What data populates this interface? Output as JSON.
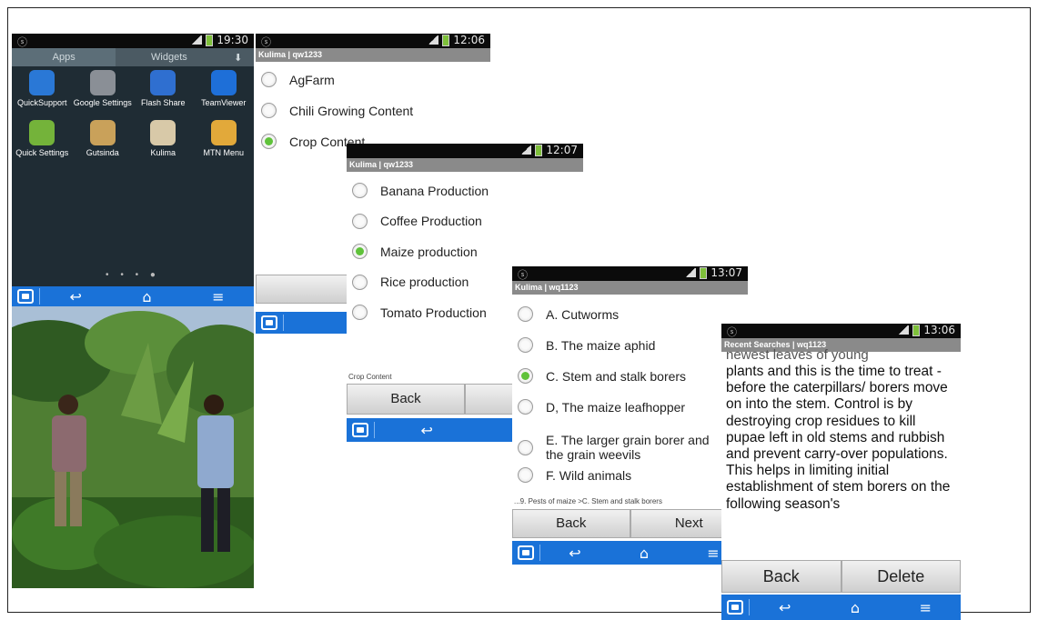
{
  "launcher": {
    "status_time": "19:30",
    "tabs": [
      "Apps",
      "Widgets"
    ],
    "apps": [
      {
        "label": "QuickSupport",
        "icon": "quicksupport-icon",
        "color": "#2a78d6"
      },
      {
        "label": "Google Settings",
        "icon": "google-settings-icon",
        "color": "#8a8f96"
      },
      {
        "label": "Flash Share",
        "icon": "flash-share-icon",
        "color": "#2f6fd0"
      },
      {
        "label": "TeamViewer",
        "icon": "teamviewer-icon",
        "color": "#1e6fd8"
      },
      {
        "label": "Quick Settings",
        "icon": "quick-settings-icon",
        "color": "#74b33a"
      },
      {
        "label": "Gutsinda",
        "icon": "gutsinda-icon",
        "color": "#c9a15a"
      },
      {
        "label": "Kulima",
        "icon": "kulima-icon",
        "color": "#d8c9a8"
      },
      {
        "label": "MTN Menu",
        "icon": "mtn-menu-icon",
        "color": "#e2a93a"
      }
    ]
  },
  "screen1": {
    "status_time": "12:06",
    "title": "Kulima | qw1233",
    "options": [
      {
        "label": "AgFarm",
        "selected": false
      },
      {
        "label": "Chili Growing Content",
        "selected": false
      },
      {
        "label": "Crop Content",
        "selected": true
      }
    ]
  },
  "screen2": {
    "status_time": "12:07",
    "title": "Kulima | qw1233",
    "options": [
      {
        "label": "Banana Production",
        "selected": false
      },
      {
        "label": "Coffee Production",
        "selected": false
      },
      {
        "label": "Maize production",
        "selected": true
      },
      {
        "label": "Rice production",
        "selected": false
      },
      {
        "label": "Tomato Production",
        "selected": false
      }
    ],
    "breadcrumb": "Crop Content",
    "back_label": "Back"
  },
  "screen3": {
    "status_time": "13:07",
    "title": "Kulima | wq1123",
    "options": [
      {
        "label": "A. Cutworms",
        "selected": false
      },
      {
        "label": "B. The maize aphid",
        "selected": false
      },
      {
        "label": "C. Stem and stalk borers",
        "selected": true
      },
      {
        "label": "D, The maize leafhopper",
        "selected": false
      },
      {
        "label": "E. The larger grain borer and the grain weevils",
        "selected": false
      },
      {
        "label": "F. Wild animals",
        "selected": false
      }
    ],
    "breadcrumb": "...9. Pests of maize >C. Stem and stalk borers",
    "back_label": "Back",
    "next_label": "Next"
  },
  "screen4": {
    "status_time": "13:06",
    "title": "Recent Searches | wq1123",
    "text_top": "newest leaves of young",
    "body": "plants and this is the time to treat - before the caterpillars/ borers move on into the stem. Control is by destroying crop residues to kill pupae left in old stems and rubbish and prevent carry-over populations. This helps in limiting initial establishment of stem borers on the following season's",
    "back_label": "Back",
    "delete_label": "Delete"
  },
  "photo": {
    "sky_color": "#a9bfd6",
    "foliage_color": "#3f6b2a"
  }
}
